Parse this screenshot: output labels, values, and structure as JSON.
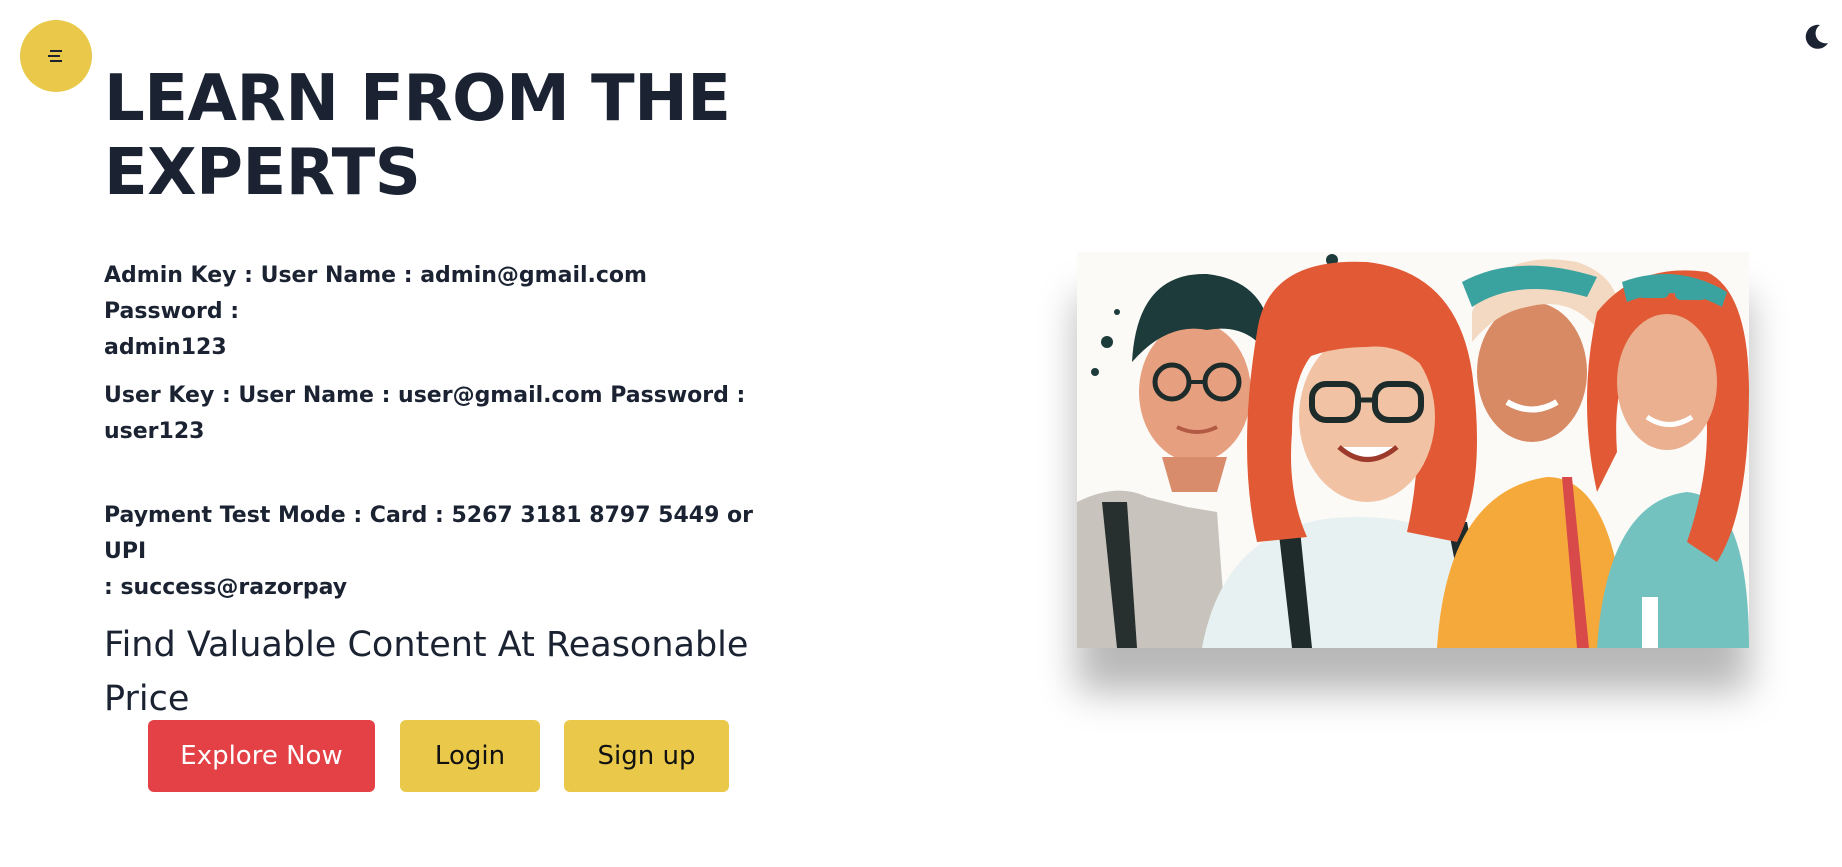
{
  "header": {
    "menu_icon": "menu-icon",
    "theme_icon": "moon-icon"
  },
  "hero": {
    "headline_line1": "LEARN FROM THE",
    "headline_line2": "EXPERTS",
    "admin_line1": "Admin Key : User Name : admin@gmail.com Password :",
    "admin_line2": "admin123",
    "user_line1": "User Key : User Name : user@gmail.com Password :",
    "user_line2": "user123",
    "payment_line1": "Payment Test Mode : Card : 5267 3181 8797 5449 or UPI",
    "payment_line2": ": success@razorpay",
    "tagline_line1": "Find Valuable Content At Reasonable",
    "tagline_line2": "Price"
  },
  "buttons": {
    "explore": "Explore Now",
    "login": "Login",
    "signup": "Sign up"
  },
  "colors": {
    "accent_yellow": "#e9c84a",
    "accent_red": "#e34146",
    "text_dark": "#1b2333"
  },
  "image": {
    "subject": "illustration-four-smiling-students"
  }
}
